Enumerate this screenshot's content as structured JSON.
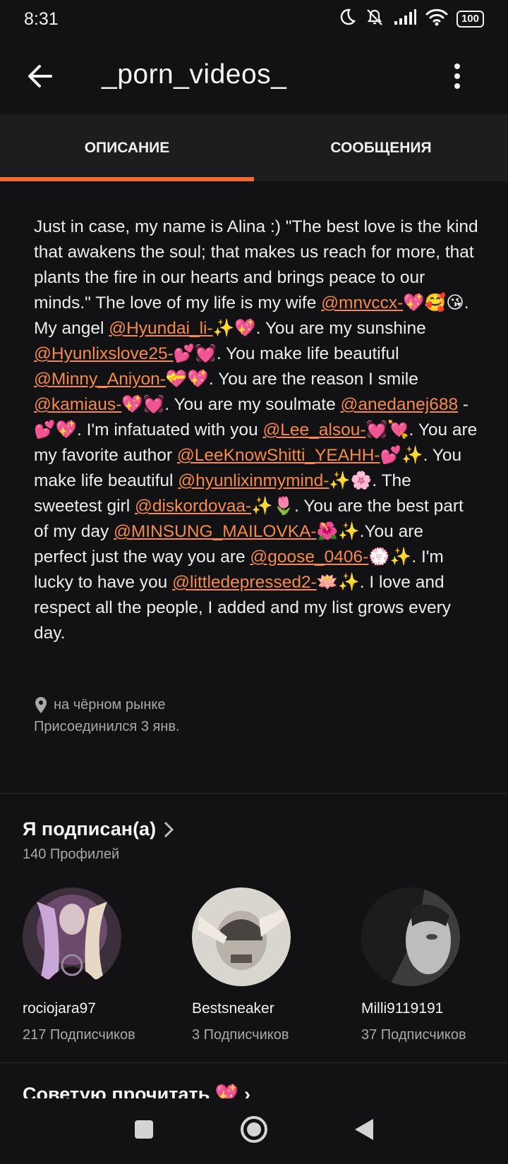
{
  "status": {
    "time": "8:31",
    "battery": "100"
  },
  "header": {
    "title": "_porn_videos_"
  },
  "tabs": [
    {
      "label": "ОПИСАНИЕ",
      "active": true
    },
    {
      "label": "СООБЩЕНИЯ",
      "active": false
    }
  ],
  "bio": {
    "t1": "Just in case, my name is Alina :) \"The best love is the kind that awakens the soul; that makes us reach for more, that plants the fire in our hearts and brings peace to our minds.\" The love of my life is my wife ",
    "m1": "@mnvccx-",
    "t2": "💖🥰😘. My angel ",
    "m2": "@Hyundai_li-",
    "t3": "✨💖. You are my sunshine ",
    "m3": "@Hyunlixslove25-",
    "t4": "💕💓. You make life beautiful ",
    "m4": "@Minny_Aniyon-",
    "t5": "💝💖. You are the reason I smile ",
    "m5": "@kamiaus-",
    "t6": "💖💓. You are my soulmate ",
    "m6": "@anedanej688",
    "t7": " -💕💖. I'm infatuated with you ",
    "m7": "@Lee_alsou-",
    "t8": "💓💘. You are my favorite author ",
    "m8": "@LeeKnowShitti_YEAHH-",
    "t9": "💕✨. You make life beautiful ",
    "m9": "@hyunlixinmymind-",
    "t10": "✨🌸. The sweetest girl ",
    "m10": "@diskordovaa-",
    "t11": "✨🌷. You are the best part of my day ",
    "m11": "@MINSUNG_MAILOVKA-",
    "t12": "🌺✨.You are perfect just the way you are ",
    "m12": "@goose_0406-",
    "t13": "💮✨. I'm lucky to have you ",
    "m13": "@littledepressed2-",
    "t14": "🪷✨. I love and respect all the people, I added and my list grows every day."
  },
  "meta": {
    "location": "на чёрном рынке",
    "joined": "Присоединился 3 янв."
  },
  "following": {
    "title": "Я подписан(а)",
    "count": "140 Профилей",
    "profiles": [
      {
        "name": "rociojara97",
        "followers": "217 Подписчиков"
      },
      {
        "name": "Bestsneaker",
        "followers": "3 Подписчиков"
      },
      {
        "name": "Milli9119191",
        "followers": "37 Подписчиков"
      }
    ]
  },
  "next_section": {
    "title": "Советую прочитать 💖 ›"
  },
  "colors": {
    "accent": "#f26a2e",
    "mention": "#f58a4c",
    "background": "#121113"
  }
}
